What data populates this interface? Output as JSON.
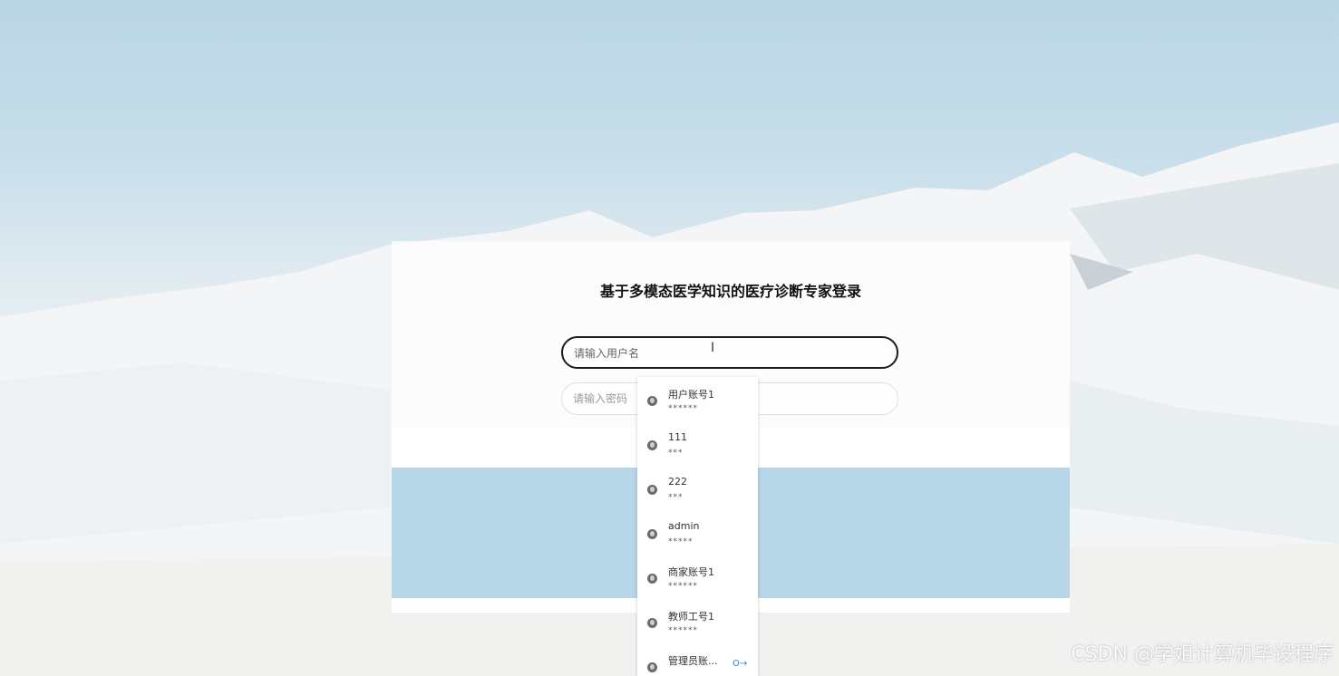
{
  "login": {
    "title": "基于多模态医学知识的医疗诊断专家登录",
    "username_placeholder": "请输入用户名",
    "password_placeholder": "请输入密码"
  },
  "autofill": {
    "items": [
      {
        "user": "用户账号1",
        "mask": "******"
      },
      {
        "user": "111",
        "mask": "***"
      },
      {
        "user": "222",
        "mask": "***"
      },
      {
        "user": "admin",
        "mask": "*****"
      },
      {
        "user": "商家账号1",
        "mask": "******"
      },
      {
        "user": "教师工号1",
        "mask": "******"
      },
      {
        "user": "管理员账...",
        "mask": ""
      }
    ],
    "key_icon": "key-icon"
  },
  "watermark": "CSDN @学姐计算机毕设程序",
  "colors": {
    "sky": "#b9d5e4",
    "panel_blue": "#b7d6e8",
    "input_border": "#1b1b1b"
  }
}
